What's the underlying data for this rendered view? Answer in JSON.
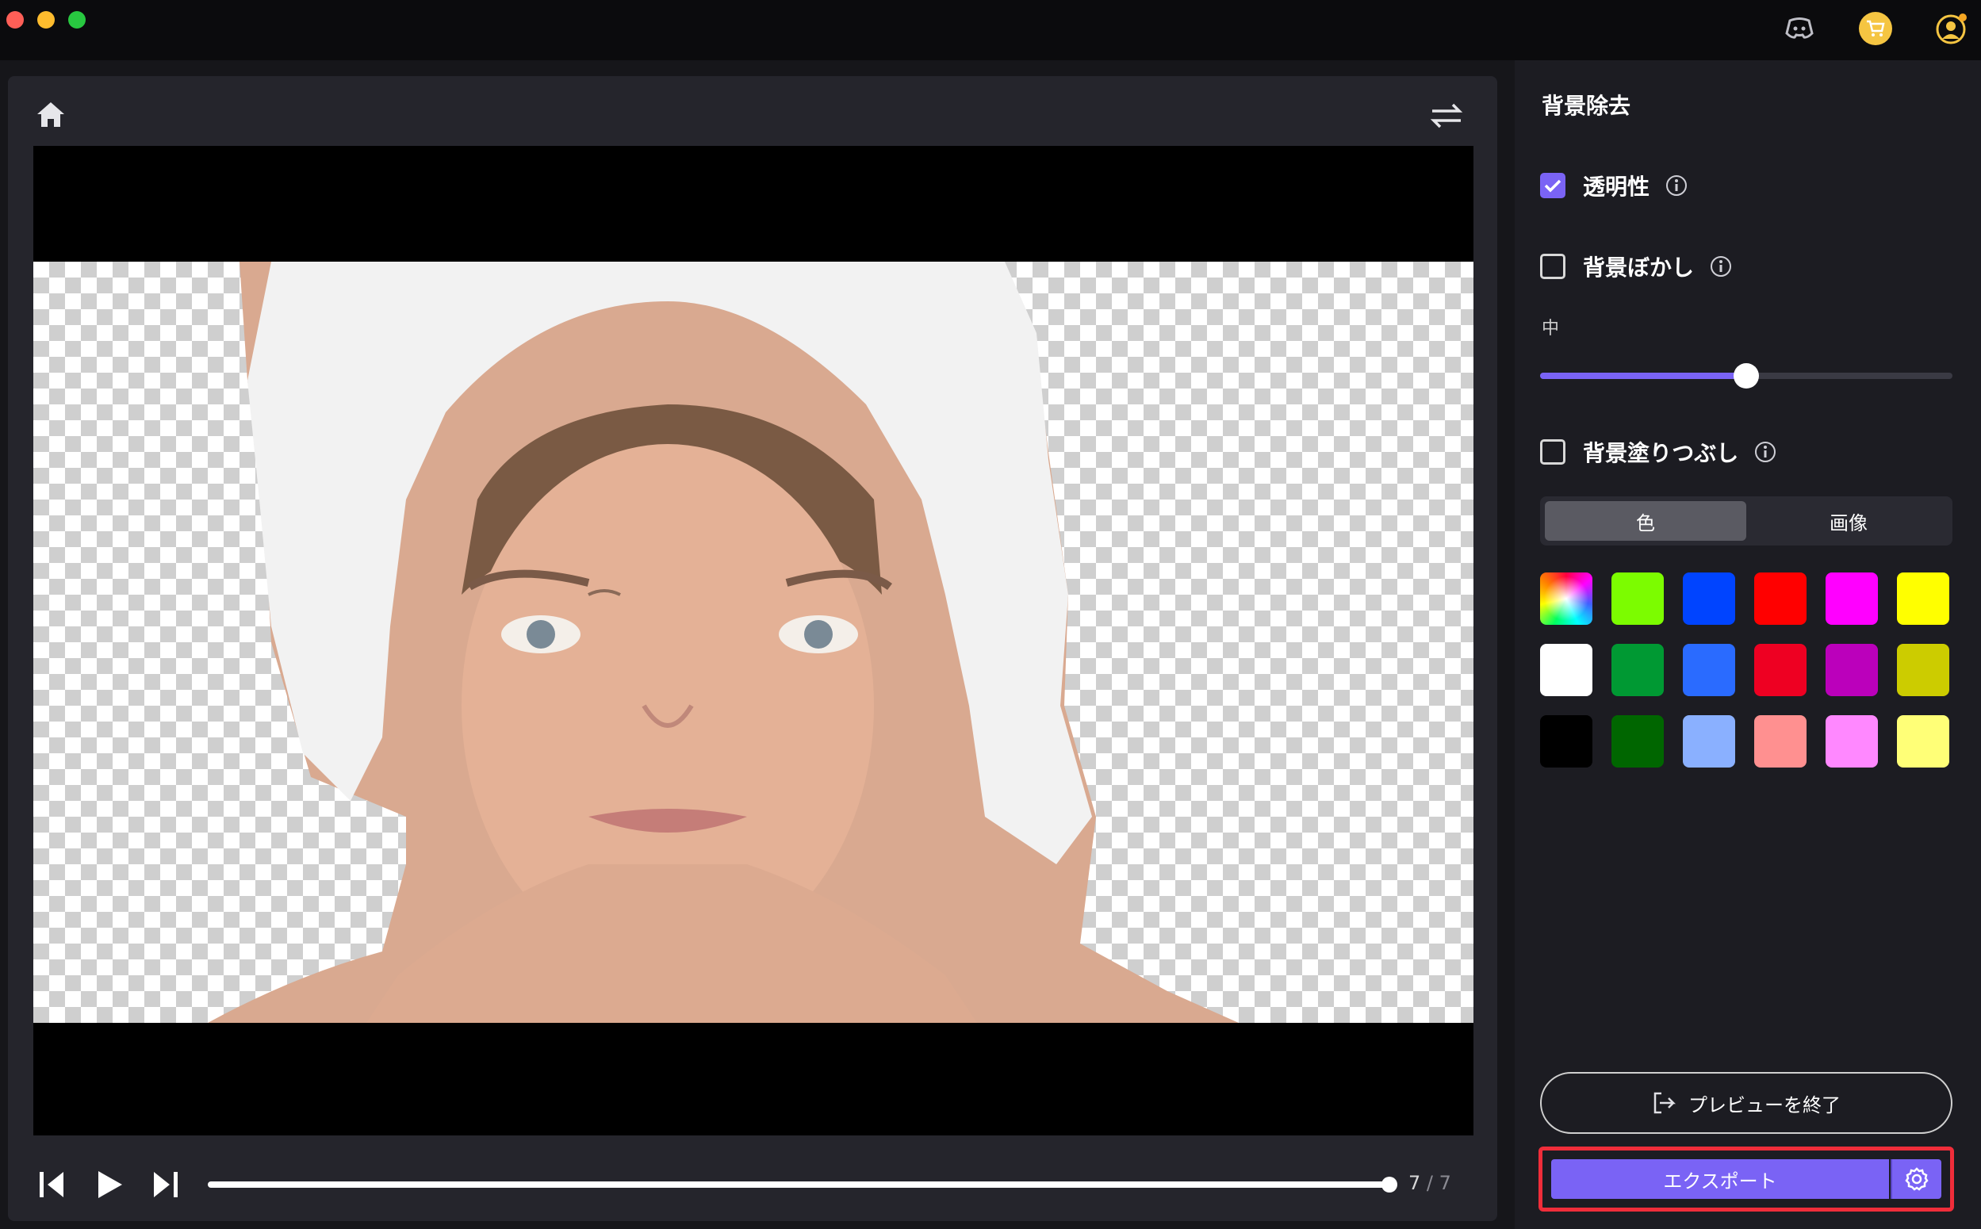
{
  "panel": {
    "title": "背景除去",
    "transparency": {
      "label": "透明性",
      "checked": true
    },
    "background_blur": {
      "label": "背景ぼかし",
      "checked": false,
      "level_label": "中",
      "level_fraction": 0.5
    },
    "background_fill": {
      "label": "背景塗りつぶし",
      "checked": false
    },
    "tabs": [
      {
        "label": "色",
        "selected": true
      },
      {
        "label": "画像",
        "selected": false
      }
    ],
    "swatches": [
      [
        "rainbow",
        "#7cfc00",
        "#0044ff",
        "#ff0000",
        "#ff00ff",
        "#ffff00"
      ],
      [
        "#ffffff",
        "#009933",
        "#2a6bff",
        "#ee0022",
        "#bb00bb",
        "#cccc00"
      ],
      [
        "#000000",
        "#006600",
        "#8ab0ff",
        "#ff9090",
        "#ff88ff",
        "#ffff77"
      ]
    ],
    "exit_preview_label": "プレビューを終了",
    "export_label": "エクスポート"
  },
  "player": {
    "current": "7",
    "separator": "/",
    "total": "7",
    "progress_fraction": 1.0
  },
  "colors": {
    "accent": "#7a63f5",
    "highlight": "#f02d3a"
  }
}
